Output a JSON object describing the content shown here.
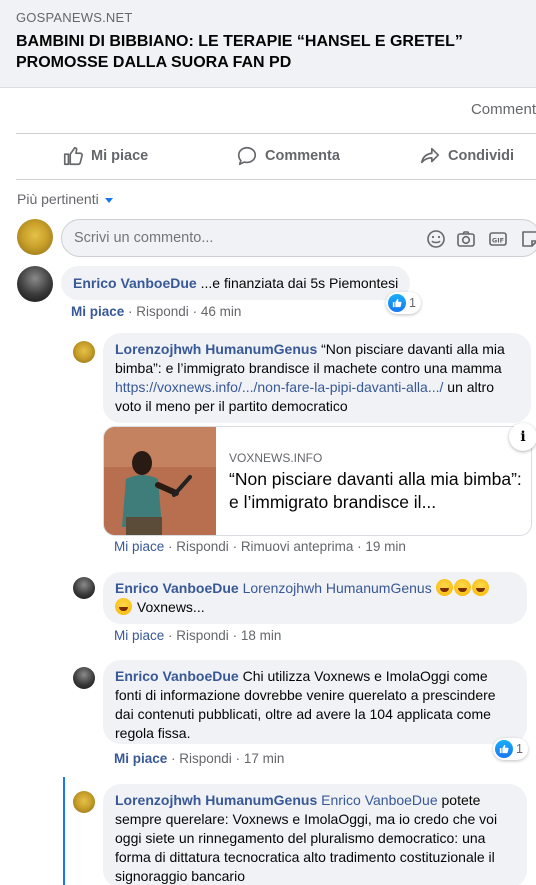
{
  "link": {
    "domain": "GOSPANEWS.NET",
    "title": "BAMBINI DI BIBBIANO: LE TERAPIE “HANSEL E GRETEL” PROMOSSE DALLA SUORA FAN PD"
  },
  "counts_text": "Comment",
  "actions": {
    "like": "Mi piace",
    "comment": "Commenta",
    "share": "Condividi"
  },
  "sort_label": "Più pertinenti",
  "composer_placeholder": "Scrivi un commento...",
  "comments": [
    {
      "author": "Enrico VanboeDue",
      "text": "...e finanziata dai 5s Piemontesi",
      "like": "Mi piace",
      "reply": "Rispondi",
      "time": "46 min",
      "reactions": "1"
    },
    {
      "author": "Lorenzojhwh HumanumGenus",
      "text_1": "“Non pisciare davanti alla mia bimba”: e l’immigrato brandisce il machete contro una mamma ",
      "url": "https://voxnews.info/.../non-fare-la-pipi-davanti-alla.../",
      "text_2": "un altro voto il meno per il partito democratico",
      "preview_domain": "VOXNEWS.INFO",
      "preview_title": "“Non pisciare davanti alla mia bimba”: e l’immigrato brandisce il...",
      "like": "Mi piace",
      "reply": "Rispondi",
      "remove_preview": "Rimuovi anteprima",
      "time": "19 min"
    },
    {
      "author": "Enrico VanboeDue",
      "tag": "Lorenzojhwh HumanumGenus",
      "text": "Voxnews...",
      "like": "Mi piace",
      "reply": "Rispondi",
      "time": "18 min"
    },
    {
      "author": "Enrico VanboeDue",
      "text": "Chi utilizza Voxnews e ImolaOggi come fonti di informazione dovrebbe venire querelato a prescindere dai contenuti pubblicati, oltre ad avere la 104 applicata come regola fissa.",
      "like": "Mi piace",
      "reply": "Rispondi",
      "time": "17 min",
      "reactions": "1"
    },
    {
      "author": "Lorenzojhwh HumanumGenus",
      "tag": "Enrico VanboeDue",
      "text": "potete sempre querelare: Voxnews e ImolaOggi, ma io credo che voi oggi siete un rinnegamento del pluralismo democratico: una forma di dittatura tecnocratica alto tradimento costituzionale il signoraggio bancario"
    }
  ],
  "colors": {
    "link_blue": "#385898",
    "fb_blue": "#1877f2",
    "bubble": "#f0f2f5",
    "muted": "#65676b"
  }
}
